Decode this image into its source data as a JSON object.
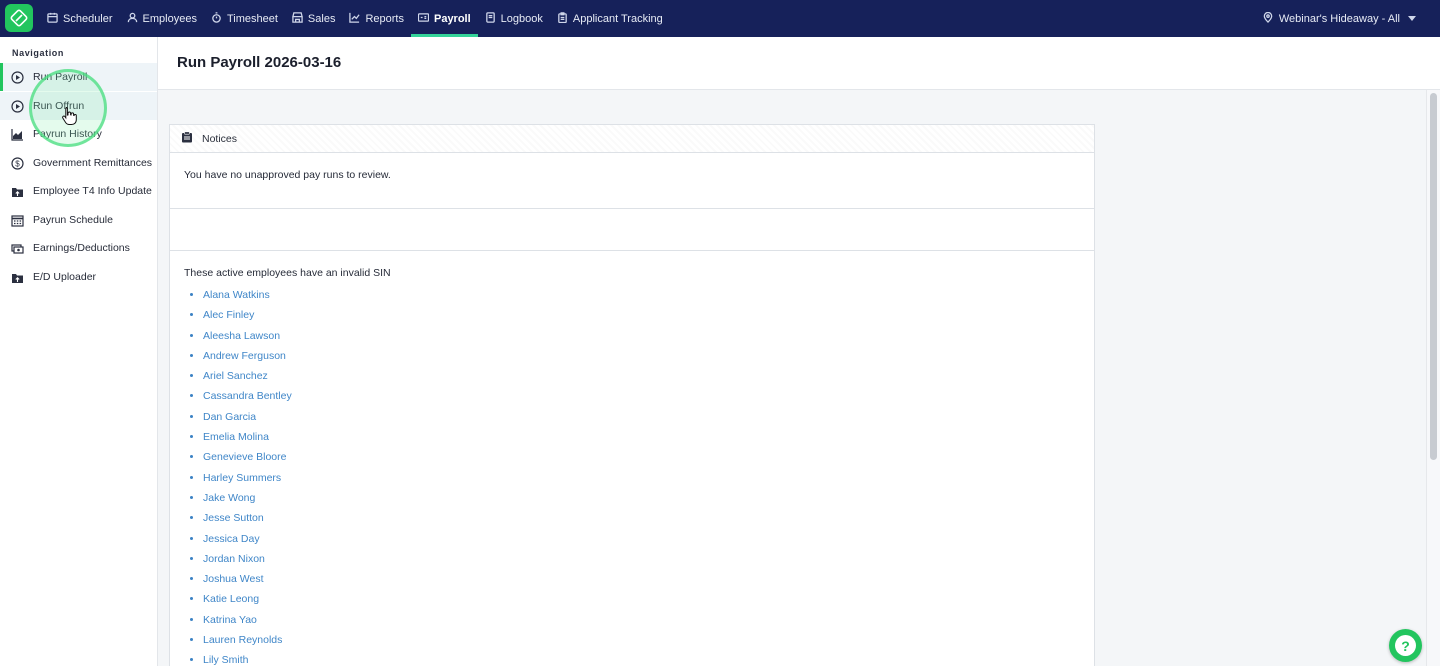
{
  "topbar": {
    "nav": [
      {
        "label": "Scheduler",
        "icon": "calendar-icon"
      },
      {
        "label": "Employees",
        "icon": "person-icon"
      },
      {
        "label": "Timesheet",
        "icon": "stopwatch-icon"
      },
      {
        "label": "Sales",
        "icon": "store-icon"
      },
      {
        "label": "Reports",
        "icon": "chart-icon"
      },
      {
        "label": "Payroll",
        "icon": "payroll-icon",
        "active": true
      },
      {
        "label": "Logbook",
        "icon": "book-icon"
      },
      {
        "label": "Applicant Tracking",
        "icon": "clipboard-icon"
      }
    ],
    "location": "Webinar's Hideaway - All",
    "accent": "#34d399",
    "background": "#16215a"
  },
  "sidebar": {
    "heading": "Navigation",
    "items": [
      {
        "label": "Run Payroll",
        "icon": "play-circle-icon"
      },
      {
        "label": "Run Offrun",
        "icon": "play-circle-icon"
      },
      {
        "label": "Payrun History",
        "icon": "area-chart-icon"
      },
      {
        "label": "Government Remittances",
        "icon": "dollar-circle-icon"
      },
      {
        "label": "Employee T4 Info Update",
        "icon": "folder-upload-icon"
      },
      {
        "label": "Payrun Schedule",
        "icon": "calendar-grid-icon"
      },
      {
        "label": "Earnings/Deductions",
        "icon": "money-icon"
      },
      {
        "label": "E/D Uploader",
        "icon": "folder-upload-icon"
      }
    ]
  },
  "page": {
    "title": "Run Payroll 2026-03-16"
  },
  "notices": {
    "header": "Notices",
    "no_unapproved": "You have no unapproved pay runs to review.",
    "invalid_sin_title": "These active employees have an invalid SIN",
    "employees": [
      "Alana Watkins",
      "Alec Finley",
      "Aleesha Lawson",
      "Andrew Ferguson",
      "Ariel Sanchez",
      "Cassandra Bentley",
      "Dan Garcia",
      "Emelia Molina",
      "Genevieve Bloore",
      "Harley Summers",
      "Jake Wong",
      "Jesse Sutton",
      "Jessica Day",
      "Jordan Nixon",
      "Joshua West",
      "Katie Leong",
      "Katrina Yao",
      "Lauren Reynolds",
      "Lily Smith"
    ]
  },
  "help": {
    "label": "?",
    "color": "#22c55e"
  }
}
